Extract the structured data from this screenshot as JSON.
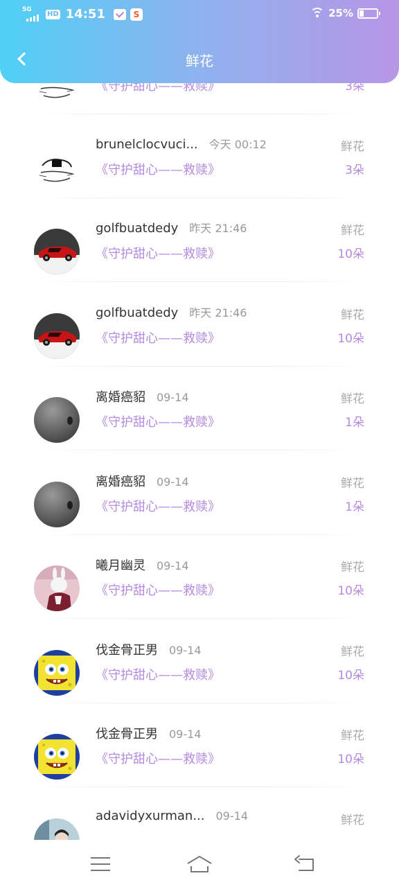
{
  "status_bar": {
    "network": "5G",
    "hd": "HD",
    "time": "14:51",
    "notif_app": "S",
    "battery": "25%"
  },
  "header": {
    "title": "鲜花"
  },
  "partial_top": {
    "gift": "《守护甜心——救赎》",
    "count": "3朵"
  },
  "rows": [
    {
      "name": "brunelclocvuci...",
      "when": "今天 00:12",
      "gift": "《守护甜心——救赎》",
      "type": "鲜花",
      "count": "3朵",
      "avatar": "sketch-avatar"
    },
    {
      "name": "golfbuatdedy",
      "when": "昨天 21:46",
      "gift": "《守护甜心——救赎》",
      "type": "鲜花",
      "count": "10朵",
      "avatar": "red-car-avatar"
    },
    {
      "name": "golfbuatdedy",
      "when": "昨天 21:46",
      "gift": "《守护甜心——救赎》",
      "type": "鲜花",
      "count": "10朵",
      "avatar": "red-car-avatar"
    },
    {
      "name": "离婚癌貂",
      "when": "09-14",
      "gift": "《守护甜心——救赎》",
      "type": "鲜花",
      "count": "1朵",
      "avatar": "gray-avatar"
    },
    {
      "name": "离婚癌貂",
      "when": "09-14",
      "gift": "《守护甜心——救赎》",
      "type": "鲜花",
      "count": "1朵",
      "avatar": "gray-avatar"
    },
    {
      "name": "曦月幽灵",
      "when": "09-14",
      "gift": "《守护甜心——救赎》",
      "type": "鲜花",
      "count": "10朵",
      "avatar": "rabbit-avatar"
    },
    {
      "name": "伐金骨正男",
      "when": "09-14",
      "gift": "《守护甜心——救赎》",
      "type": "鲜花",
      "count": "10朵",
      "avatar": "spongebob-avatar"
    },
    {
      "name": "伐金骨正男",
      "when": "09-14",
      "gift": "《守护甜心——救赎》",
      "type": "鲜花",
      "count": "10朵",
      "avatar": "spongebob-avatar"
    },
    {
      "name": "adavidyxurman...",
      "when": "09-14",
      "gift": "",
      "type": "鲜花",
      "count": "",
      "avatar": "photo-avatar"
    }
  ],
  "nav": {
    "menu_icon": "menu-icon",
    "home_icon": "home-icon",
    "back_icon": "back-icon"
  }
}
